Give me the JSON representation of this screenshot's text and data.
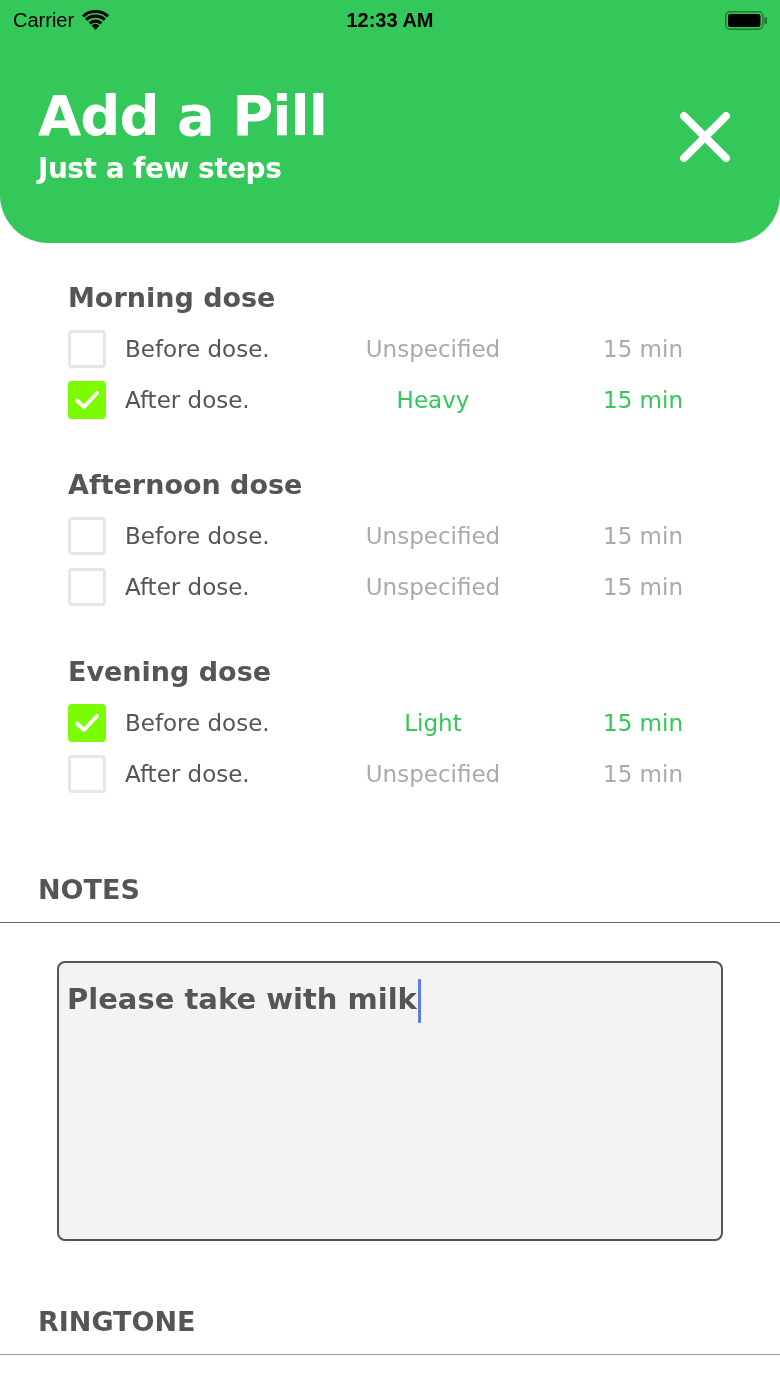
{
  "status_bar": {
    "carrier": "Carrier",
    "time": "12:33 AM"
  },
  "header": {
    "title": "Add a Pill",
    "subtitle": "Just a few steps"
  },
  "dose_sections": [
    {
      "title": "Morning dose",
      "rows": [
        {
          "label": "Before dose.",
          "checked": false,
          "amount": "Unspecified",
          "time": "15 min"
        },
        {
          "label": "After dose.",
          "checked": true,
          "amount": "Heavy",
          "time": "15 min"
        }
      ]
    },
    {
      "title": "Afternoon dose",
      "rows": [
        {
          "label": "Before dose.",
          "checked": false,
          "amount": "Unspecified",
          "time": "15 min"
        },
        {
          "label": "After dose.",
          "checked": false,
          "amount": "Unspecified",
          "time": "15 min"
        }
      ]
    },
    {
      "title": "Evening dose",
      "rows": [
        {
          "label": "Before dose.",
          "checked": true,
          "amount": "Light",
          "time": "15 min"
        },
        {
          "label": "After dose.",
          "checked": false,
          "amount": "Unspecified",
          "time": "15 min"
        }
      ]
    }
  ],
  "notes": {
    "label": "NOTES",
    "value": "Please take with milk",
    "focused": true
  },
  "ringtone": {
    "label": "RINGTONE"
  }
}
